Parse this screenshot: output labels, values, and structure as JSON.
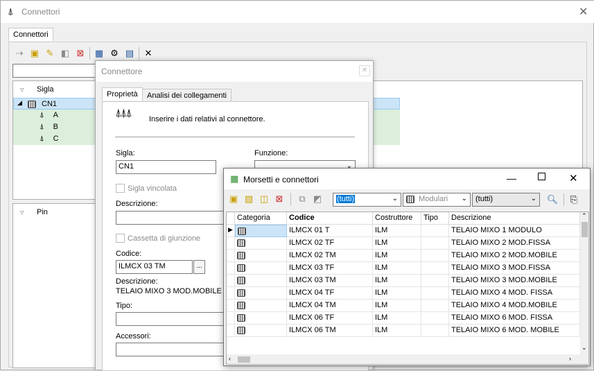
{
  "main": {
    "title": "Connettori",
    "tab": "Connettori",
    "tree_header": "Sigla",
    "tree_items": [
      {
        "label": "CN1"
      },
      {
        "label": "A"
      },
      {
        "label": "B"
      },
      {
        "label": "C"
      }
    ],
    "pin_header": "Pin"
  },
  "connector_dialog": {
    "title": "Connettore",
    "tabs": [
      "Proprietà",
      "Analisi dei collegamenti"
    ],
    "intro": "Inserire i dati relativi al connettore.",
    "sigla_label": "Sigla:",
    "sigla_value": "CN1",
    "funzione_label": "Funzione:",
    "sigla_vincolata": "Sigla vincolata",
    "descrizione_label": "Descrizione:",
    "cassetta": "Cassetta di giunzione",
    "codice_label": "Codice:",
    "codice_value": "ILMCX 03 TM",
    "browse": "...",
    "descrizione2_label": "Descrizione:",
    "descrizione2_value": "TELAIO MIXO 3 MOD.MOBILE",
    "tipo_label": "Tipo:",
    "accessori_label": "Accessori:"
  },
  "catalog": {
    "title": "Morsetti e connettori",
    "filter1": "(tutti)",
    "filter2": "Modulari",
    "filter3": "(tutti)",
    "columns": [
      "Categoria",
      "Codice",
      "Costruttore",
      "Tipo",
      "Descrizione"
    ],
    "rows": [
      {
        "codice": "ILMCX 01 T",
        "costruttore": "ILM",
        "tipo": "",
        "descrizione": "TELAIO MIXO 1 MODULO"
      },
      {
        "codice": "ILMCX 02 TF",
        "costruttore": "ILM",
        "tipo": "",
        "descrizione": "TELAIO MIXO 2 MOD.FISSA"
      },
      {
        "codice": "ILMCX 02 TM",
        "costruttore": "ILM",
        "tipo": "",
        "descrizione": "TELAIO MIXO 2 MOD.MOBILE"
      },
      {
        "codice": "ILMCX 03 TF",
        "costruttore": "ILM",
        "tipo": "",
        "descrizione": "TELAIO MIXO 3 MOD.FISSA"
      },
      {
        "codice": "ILMCX 03 TM",
        "costruttore": "ILM",
        "tipo": "",
        "descrizione": "TELAIO MIXO 3 MOD.MOBILE"
      },
      {
        "codice": "ILMCX 04 TF",
        "costruttore": "ILM",
        "tipo": "",
        "descrizione": "TELAIO MIXO 4 MOD. FISSA"
      },
      {
        "codice": "ILMCX 04 TM",
        "costruttore": "ILM",
        "tipo": "",
        "descrizione": "TELAIO MIXO 4 MOD.MOBILE"
      },
      {
        "codice": "ILMCX 06 TF",
        "costruttore": "ILM",
        "tipo": "",
        "descrizione": "TELAIO MIXO 6 MOD. FISSA"
      },
      {
        "codice": "ILMCX 06 TM",
        "costruttore": "ILM",
        "tipo": "",
        "descrizione": "TELAIO MIXO 6 MOD. MOBILE"
      }
    ]
  }
}
